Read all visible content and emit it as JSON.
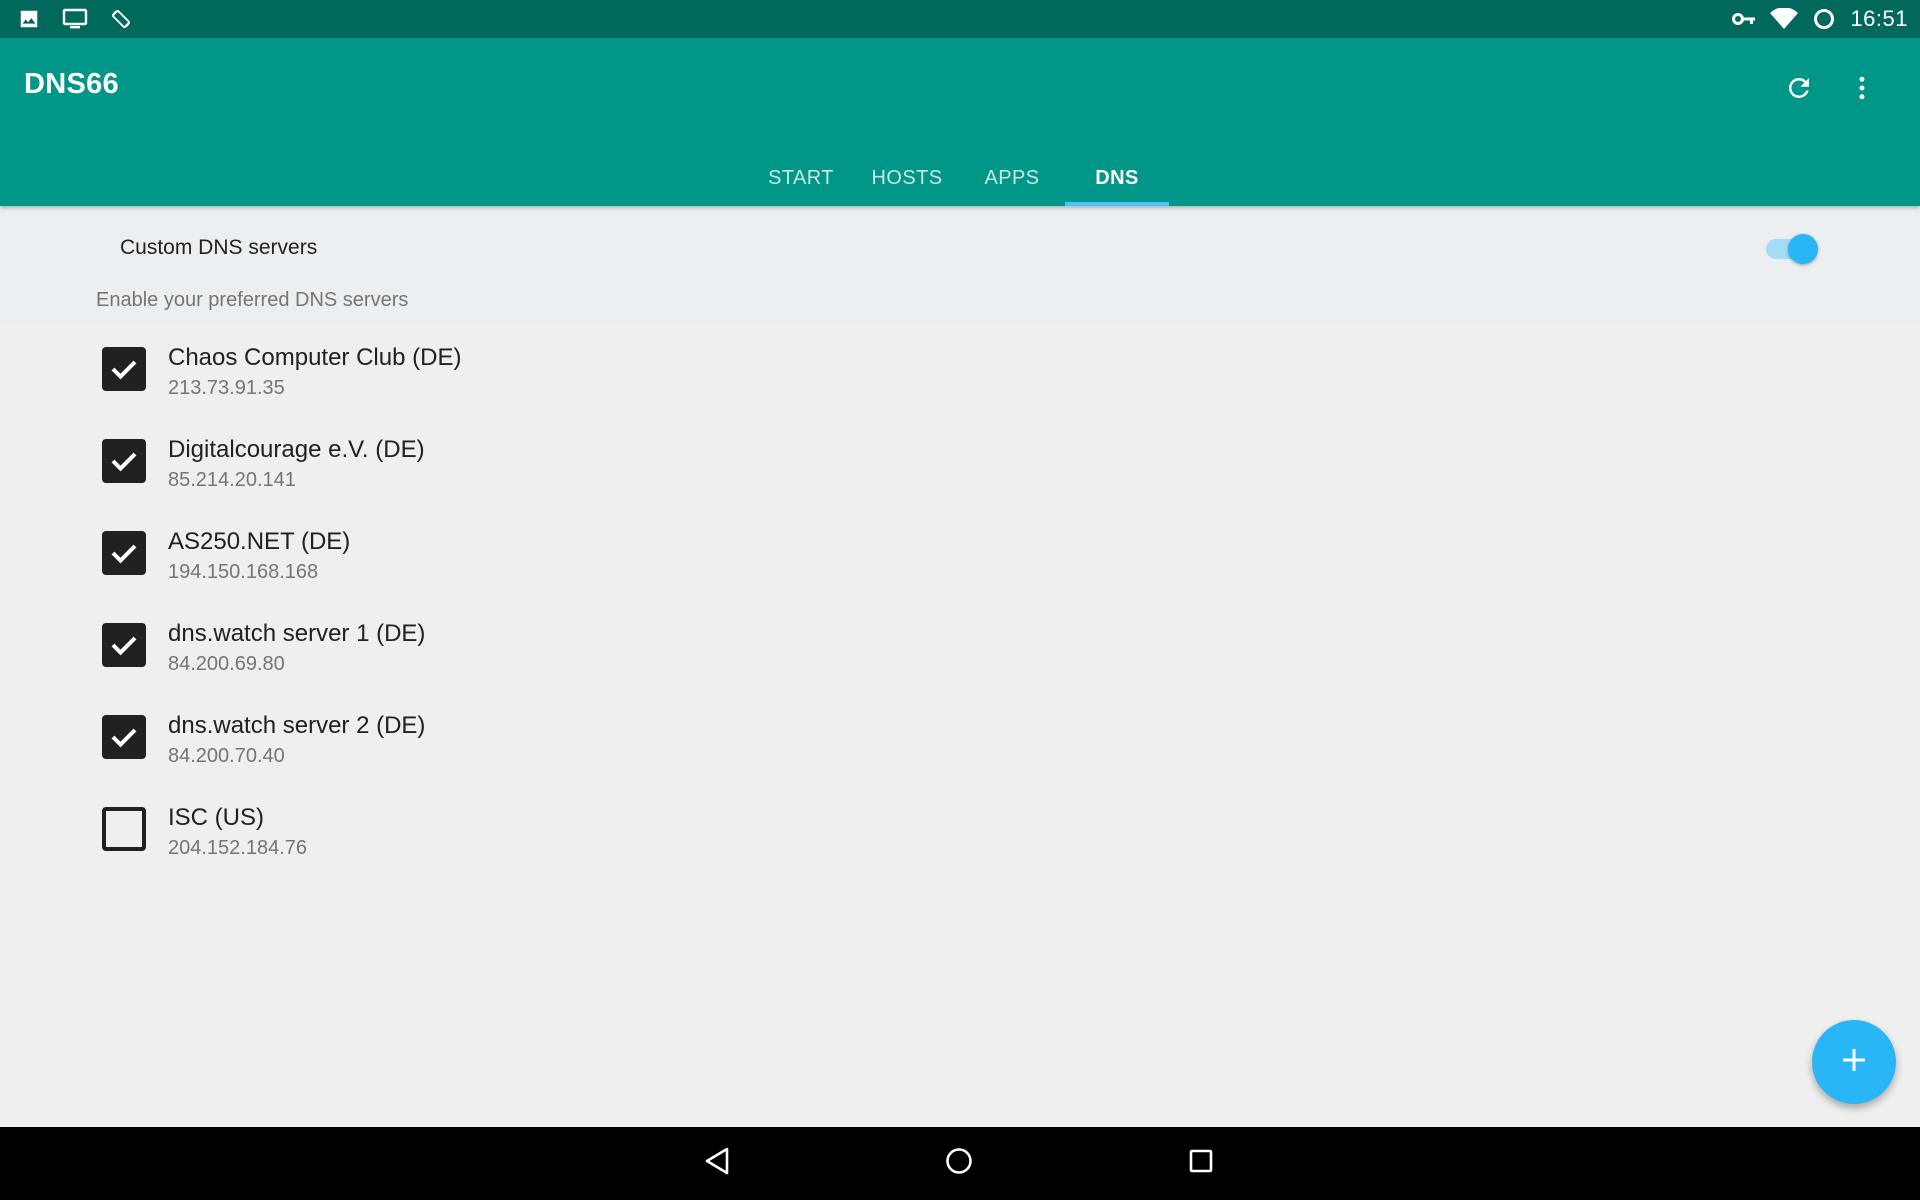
{
  "status_bar": {
    "time": "16:51",
    "icons": [
      "image-icon",
      "cast-screen-icon",
      "screen-rotation-icon",
      "vpn-key-icon",
      "wifi-icon",
      "sync-circle-icon"
    ]
  },
  "app_bar": {
    "title": "DNS66",
    "actions": [
      "refresh-icon",
      "more-vert-icon"
    ]
  },
  "tabs": [
    {
      "label": "START",
      "active": false
    },
    {
      "label": "HOSTS",
      "active": false
    },
    {
      "label": "APPS",
      "active": false
    },
    {
      "label": "DNS",
      "active": true
    }
  ],
  "custom_dns": {
    "title": "Custom DNS servers",
    "summary": "Enable your preferred DNS servers",
    "enabled": true
  },
  "dns_servers": [
    {
      "name": "Chaos Computer Club (DE)",
      "ip": "213.73.91.35",
      "checked": true
    },
    {
      "name": "Digitalcourage e.V. (DE)",
      "ip": "85.214.20.141",
      "checked": true
    },
    {
      "name": "AS250.NET (DE)",
      "ip": "194.150.168.168",
      "checked": true
    },
    {
      "name": "dns.watch server 1 (DE)",
      "ip": "84.200.69.80",
      "checked": true
    },
    {
      "name": "dns.watch server 2 (DE)",
      "ip": "84.200.70.40",
      "checked": true
    },
    {
      "name": "ISC (US)",
      "ip": "204.152.184.76",
      "checked": false
    }
  ],
  "fab": {
    "icon": "add-icon"
  },
  "nav_bar": {
    "buttons": [
      "back-icon",
      "home-icon",
      "recents-icon"
    ]
  },
  "colors": {
    "primary": "#009688",
    "primary_dark": "#00695c",
    "accent": "#29b6f6",
    "background": "#efefef"
  }
}
